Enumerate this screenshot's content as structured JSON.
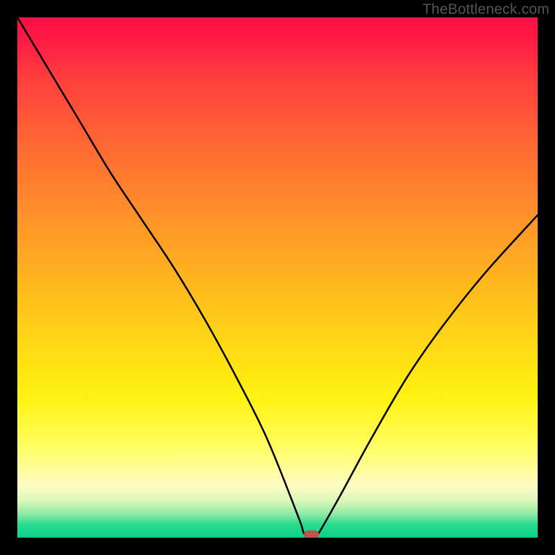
{
  "watermark": "TheBottleneck.com",
  "colors": {
    "frame_bg": "#000000",
    "curve": "#000000",
    "marker": "#bd524e"
  },
  "chart_data": {
    "type": "line",
    "title": "",
    "xlabel": "",
    "ylabel": "",
    "xlim": [
      0,
      100
    ],
    "ylim": [
      0,
      100
    ],
    "grid": false,
    "legend": false,
    "series": [
      {
        "name": "bottleneck-curve",
        "x": [
          0,
          6,
          12,
          18,
          24,
          30,
          36,
          42,
          48,
          54,
          55,
          56,
          57,
          58,
          62,
          68,
          75,
          82,
          90,
          100
        ],
        "y": [
          100,
          90,
          80,
          70,
          61,
          52,
          42,
          31,
          19,
          4,
          1,
          0,
          0,
          1,
          8,
          19,
          31,
          41,
          51,
          62
        ]
      }
    ],
    "marker": {
      "x": 56.5,
      "y": 0.5,
      "label": "optimal-point"
    },
    "background_gradient_stops": [
      {
        "pos": 0.0,
        "color": "#ff0d46"
      },
      {
        "pos": 0.25,
        "color": "#ff6a33"
      },
      {
        "pos": 0.5,
        "color": "#ffb41f"
      },
      {
        "pos": 0.73,
        "color": "#fff20f"
      },
      {
        "pos": 0.9,
        "color": "#fffcc4"
      },
      {
        "pos": 1.0,
        "color": "#06d388"
      }
    ]
  }
}
